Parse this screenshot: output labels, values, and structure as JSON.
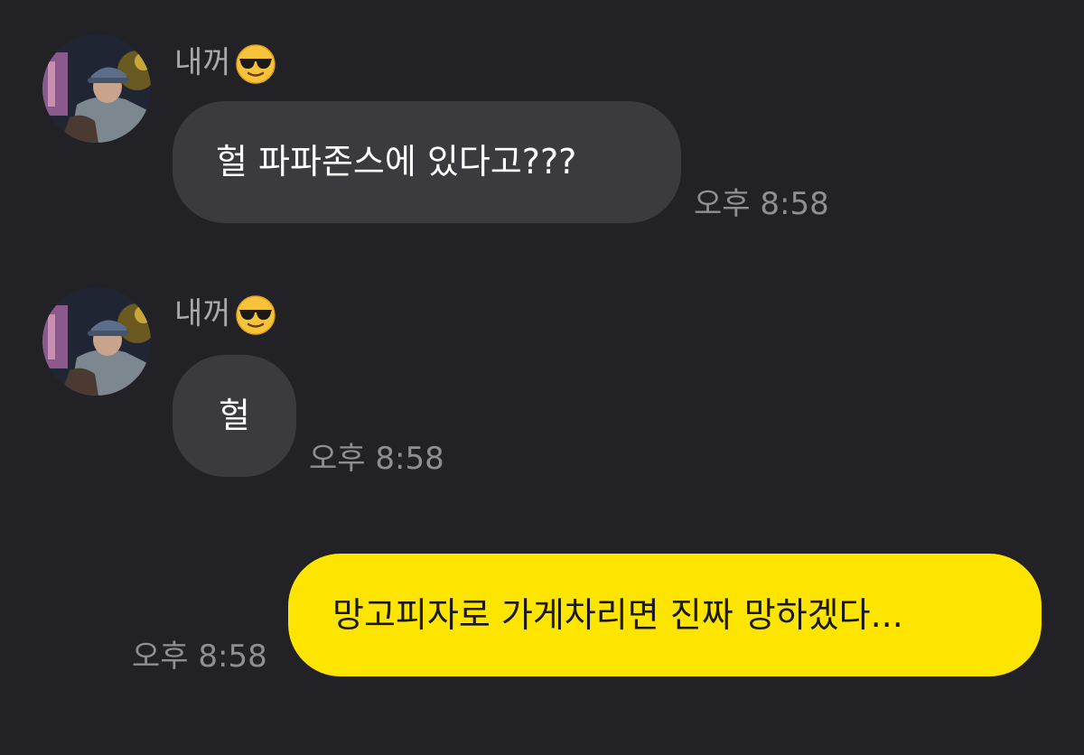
{
  "chat": {
    "messages": [
      {
        "sender": "내꺼",
        "sender_emoji": "smiling-face-with-sunglasses",
        "text": "헐 파파존스에 있다고???",
        "time": "오후 8:58",
        "own": false
      },
      {
        "sender": "내꺼",
        "sender_emoji": "smiling-face-with-sunglasses",
        "text": "헐",
        "time": "오후 8:58",
        "own": false
      },
      {
        "text": "망고피자로 가게차리면 진짜 망하겠다...",
        "time": "오후 8:58",
        "own": true
      }
    ]
  },
  "colors": {
    "background": "#222226",
    "incoming_bubble": "#3b3b3f",
    "outgoing_bubble": "#fee500",
    "sender_name": "#a8a8ad",
    "timestamp": "#8e8e93"
  }
}
